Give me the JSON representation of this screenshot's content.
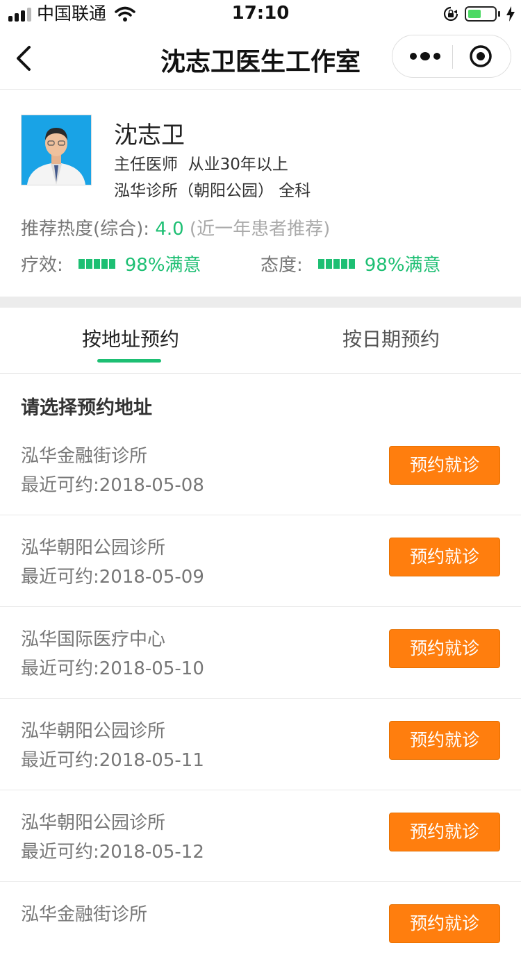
{
  "status_bar": {
    "carrier": "中国联通",
    "time": "17:10"
  },
  "nav": {
    "title": "沈志卫医生工作室"
  },
  "doctor": {
    "name": "沈志卫",
    "title_experience": "主任医师  从业30年以上",
    "clinic_dept": "泓华诊所（朝阳公园） 全科",
    "rec_label": "推荐热度(综合): ",
    "rec_score": "4.0",
    "rec_note": " (近一年患者推荐)",
    "efficacy_label": "疗效:",
    "efficacy_pct": "98%满意",
    "attitude_label": "态度:",
    "attitude_pct": "98%满意"
  },
  "tabs": [
    {
      "label": "按地址预约",
      "active": true
    },
    {
      "label": "按日期预约",
      "active": false
    }
  ],
  "section_title": "请选择预约地址",
  "locations": [
    {
      "name": "泓华金融街诊所",
      "date": "最近可约:2018-05-08",
      "button": "预约就诊"
    },
    {
      "name": "泓华朝阳公园诊所",
      "date": "最近可约:2018-05-09",
      "button": "预约就诊"
    },
    {
      "name": "泓华国际医疗中心",
      "date": "最近可约:2018-05-10",
      "button": "预约就诊"
    },
    {
      "name": "泓华朝阳公园诊所",
      "date": "最近可约:2018-05-11",
      "button": "预约就诊"
    },
    {
      "name": "泓华朝阳公园诊所",
      "date": "最近可约:2018-05-12",
      "button": "预约就诊"
    },
    {
      "name": "泓华金融街诊所",
      "date": "",
      "button": "预约就诊"
    }
  ],
  "colors": {
    "accent_green": "#1dbf73",
    "button_orange": "#ff7e0e"
  }
}
